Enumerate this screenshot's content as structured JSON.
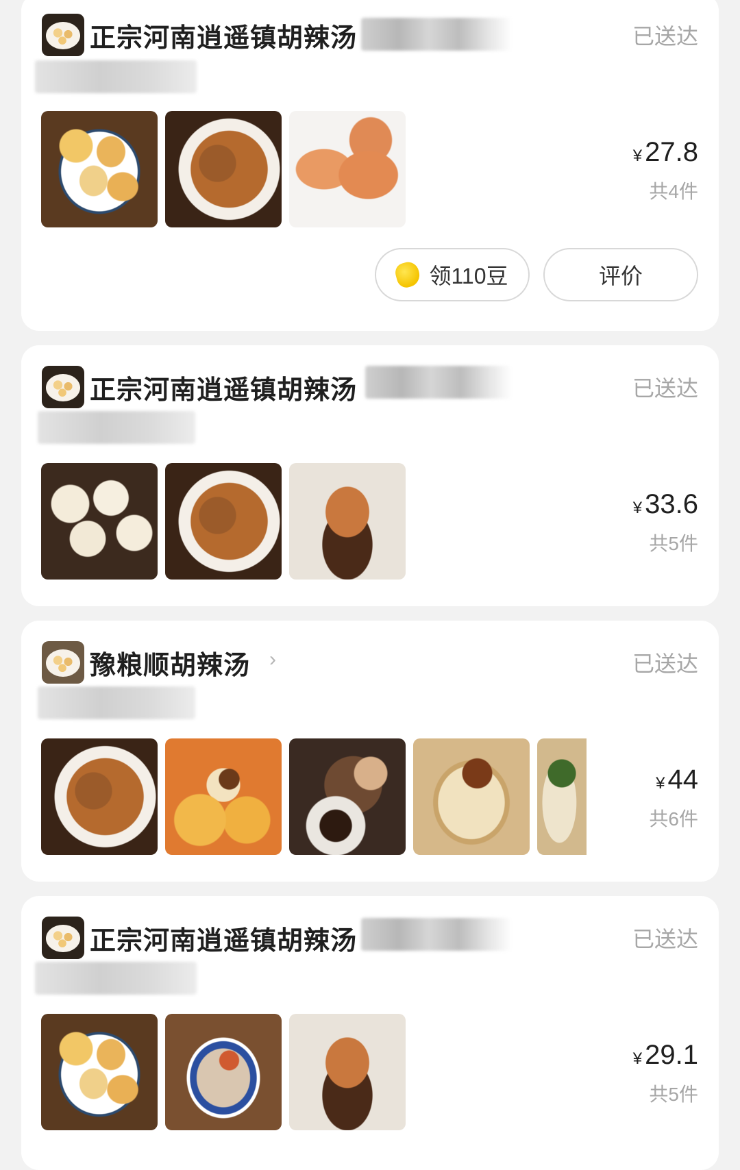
{
  "orders": [
    {
      "shop_name": "正宗河南逍遥镇胡辣汤",
      "status": "已送达",
      "price": "27.8",
      "currency": "¥",
      "count": "共4件",
      "items": [
        "fried-bun-cake-image",
        "hot-pepper-soup-image",
        "eggs-image"
      ],
      "actions": {
        "bean_label": "领110豆",
        "review_label": "评价"
      }
    },
    {
      "shop_name": "正宗河南逍遥镇胡辣汤",
      "status": "已送达",
      "price": "33.6",
      "currency": "¥",
      "count": "共5件",
      "items": [
        "steamed-buns-image",
        "hot-pepper-soup-image",
        "tea-egg-image"
      ]
    },
    {
      "shop_name": "豫粮顺胡辣汤",
      "status": "已送达",
      "price": "44",
      "currency": "¥",
      "count": "共6件",
      "items": [
        "hot-pepper-soup-image",
        "fried-bun-image",
        "tea-egg-spices-image",
        "meat-bun-image",
        "vegetable-bun-image"
      ]
    },
    {
      "shop_name": "正宗河南逍遥镇胡辣汤",
      "status": "已送达",
      "price": "29.1",
      "currency": "¥",
      "count": "共5件",
      "items": [
        "fried-bun-cake-image",
        "bowl-soup-image",
        "tea-egg-image"
      ]
    }
  ]
}
